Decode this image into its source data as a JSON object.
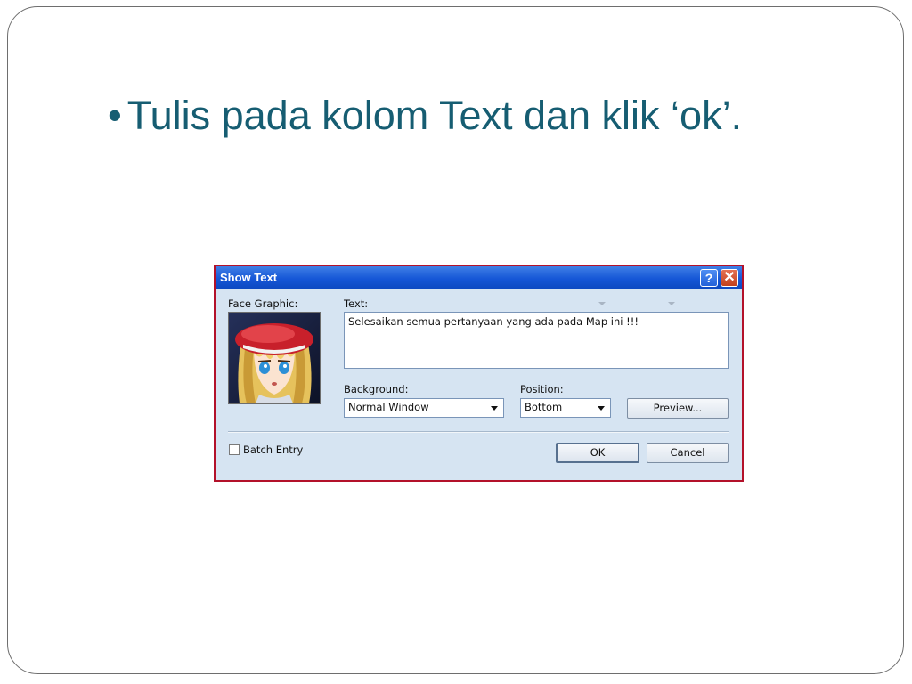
{
  "slide": {
    "bullet_char": "•",
    "bullet_text": "Tulis pada kolom Text dan klik ‘ok’."
  },
  "dialog": {
    "title": "Show Text",
    "help_icon": "?",
    "close_icon": "✕",
    "face_graphic_label": "Face Graphic:",
    "text_label": "Text:",
    "text_value": "Selesaikan semua pertanyaan yang ada pada Map ini !!!",
    "background_label": "Background:",
    "background_value": "Normal Window",
    "position_label": "Position:",
    "position_value": "Bottom",
    "preview_label": "Preview...",
    "batch_entry_label": "Batch Entry",
    "batch_entry_checked": false,
    "ok_label": "OK",
    "cancel_label": "Cancel"
  },
  "colors": {
    "bullet_text": "#165d72",
    "dialog_border": "#b3112a",
    "titlebar": "#1556d6",
    "client_bg": "#d6e4f2"
  }
}
